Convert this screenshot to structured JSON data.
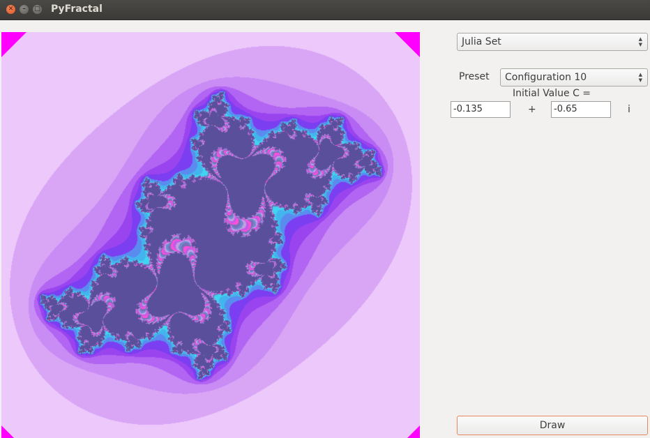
{
  "window": {
    "title": "PyFractal"
  },
  "controls": {
    "fractal_type": "Julia Set",
    "preset_label": "Preset",
    "preset_value": "Configuration 10",
    "initial_value_label": "Initial Value C =",
    "c_real": "-0.135",
    "plus_sign": "+",
    "c_imag": "-0.65",
    "imag_unit": "i",
    "draw_label": "Draw"
  },
  "fractal": {
    "kind": "julia",
    "c": [
      -0.135,
      -0.65
    ],
    "palette": [
      "#edc8fb",
      "#d9a6f6",
      "#c98bf4",
      "#b264f2",
      "#9a44f0",
      "#7b3ef0",
      "#5a8cf0",
      "#44b4ee",
      "#3fd4f0",
      "#c65ae8",
      "#ff4fd8",
      "#7a6fb8",
      "#6f8bd0",
      "#c0a0e0",
      "#5a4f9a"
    ],
    "corner_color": "#ff00ff"
  }
}
